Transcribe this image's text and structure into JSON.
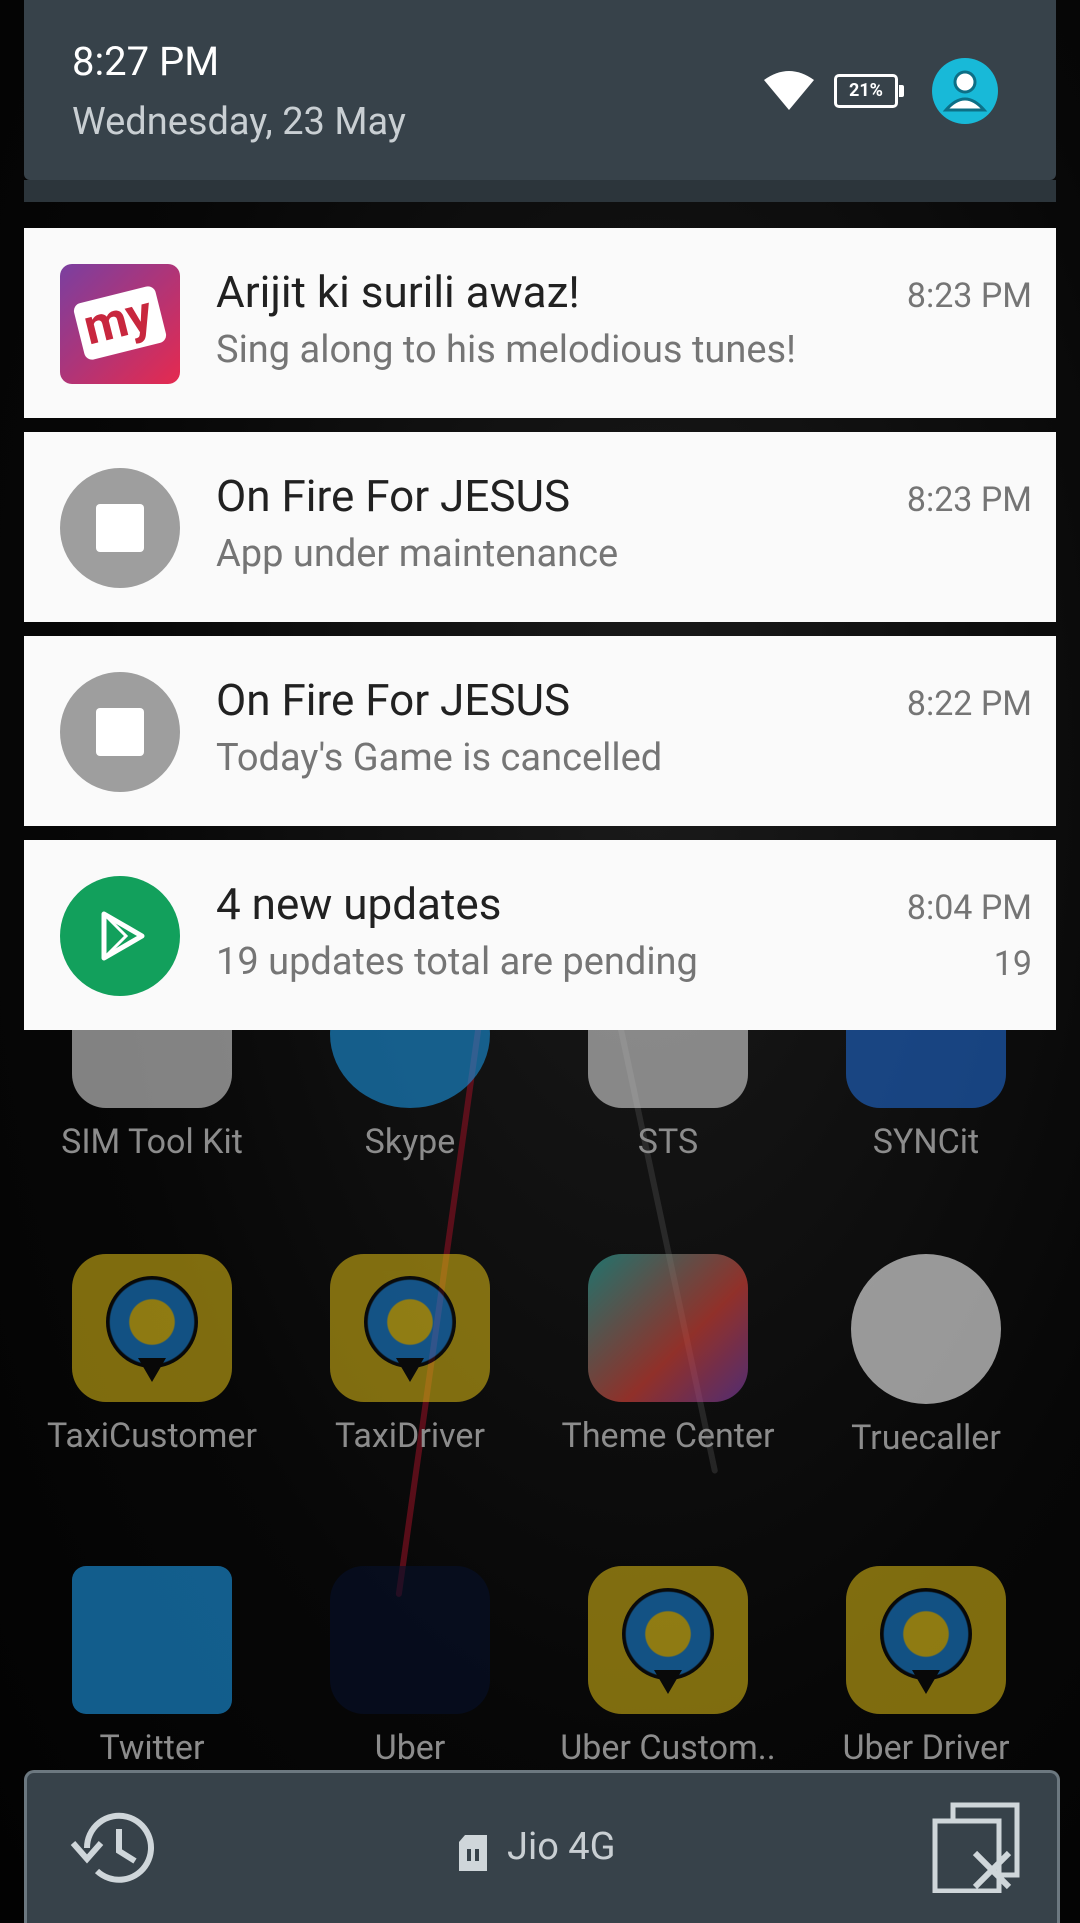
{
  "status": {
    "time": "8:27 PM",
    "date": "Wednesday, 23 May",
    "battery": "21%"
  },
  "notifications": [
    {
      "title": "Arijit ki surili awaz!",
      "text": "Sing along to his melodious tunes!",
      "time": "8:23 PM",
      "icon": "bookmyshow-icon",
      "icon_text": "my"
    },
    {
      "title": "On Fire For JESUS",
      "text": "App under maintenance",
      "time": "8:23 PM",
      "icon": "generic-app-icon"
    },
    {
      "title": "On Fire For JESUS",
      "text": "Today's Game is cancelled",
      "time": "8:22 PM",
      "icon": "generic-app-icon"
    },
    {
      "title": "4 new updates",
      "text": "19 updates total are pending",
      "time": "8:04 PM",
      "count": "19",
      "icon": "play-store-icon"
    }
  ],
  "launcher": {
    "apps": [
      {
        "label": "SIM Tool Kit"
      },
      {
        "label": "Skype"
      },
      {
        "label": "STS"
      },
      {
        "label": "SYNCit"
      },
      {
        "label": "TaxiCustomer"
      },
      {
        "label": "TaxiDriver"
      },
      {
        "label": "Theme Center"
      },
      {
        "label": "Truecaller"
      },
      {
        "label": "Twitter"
      },
      {
        "label": "Uber"
      },
      {
        "label": "Uber Custom.."
      },
      {
        "label": "Uber Driver"
      }
    ]
  },
  "bottom": {
    "carrier": "Jio 4G"
  },
  "colors": {
    "shade_header": "#37424a",
    "notification_bg": "#fafafa",
    "avatar": "#18b9d8",
    "play_store": "#12a05c"
  }
}
